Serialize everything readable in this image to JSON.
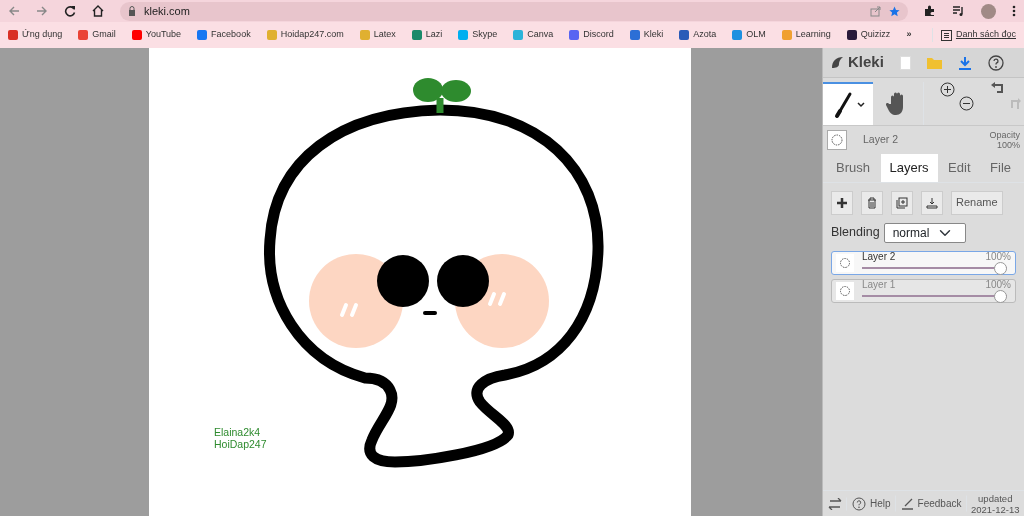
{
  "browser": {
    "url": "kleki.com",
    "bookmarks": [
      {
        "label": "Ứng dụng",
        "color": "#d93025"
      },
      {
        "label": "Gmail",
        "color": "#ea4335"
      },
      {
        "label": "YouTube",
        "color": "#ff0000"
      },
      {
        "label": "Facebook",
        "color": "#1877f2"
      },
      {
        "label": "Hoidap247.com",
        "color": "#e0b030"
      },
      {
        "label": "Latex",
        "color": "#e0b030"
      },
      {
        "label": "Lazi",
        "color": "#1a8a6a"
      },
      {
        "label": "Skype",
        "color": "#00aff0"
      },
      {
        "label": "Canva",
        "color": "#2bb3d9"
      },
      {
        "label": "Discord",
        "color": "#5865f2"
      },
      {
        "label": "Kleki",
        "color": "#2c6fd6"
      },
      {
        "label": "Azota",
        "color": "#2a5bb8"
      },
      {
        "label": "OLM",
        "color": "#1e90e0"
      },
      {
        "label": "Learning",
        "color": "#f0a030"
      },
      {
        "label": "Quizizz",
        "color": "#2a1a3a"
      }
    ],
    "more": "»",
    "reading_list": "Danh sách đọc"
  },
  "canvas": {
    "signature": [
      "Elaina2k4",
      "HoiDap247"
    ]
  },
  "panel": {
    "logo": "Kleki",
    "tools": [
      {
        "kind": "brush",
        "selected": true
      },
      {
        "kind": "hand",
        "selected": false
      }
    ],
    "current_layer": "Layer 2",
    "opacity_label": "Opacity",
    "opacity_value": "100%",
    "tabs": [
      {
        "label": "Brush",
        "selected": false
      },
      {
        "label": "Layers",
        "selected": true
      },
      {
        "label": "Edit",
        "selected": false
      },
      {
        "label": "File",
        "selected": false
      }
    ],
    "rename": "Rename",
    "blending_label": "Blending",
    "blending_value": "normal",
    "layers": [
      {
        "name": "Layer 2",
        "opacity": "100%",
        "level": 1,
        "selected": true
      },
      {
        "name": "Layer 1",
        "opacity": "100%",
        "level": 1,
        "selected": false
      }
    ],
    "footer": {
      "help": "Help",
      "feedback": "Feedback",
      "updated": "updated",
      "date": "2021-12-13"
    }
  }
}
